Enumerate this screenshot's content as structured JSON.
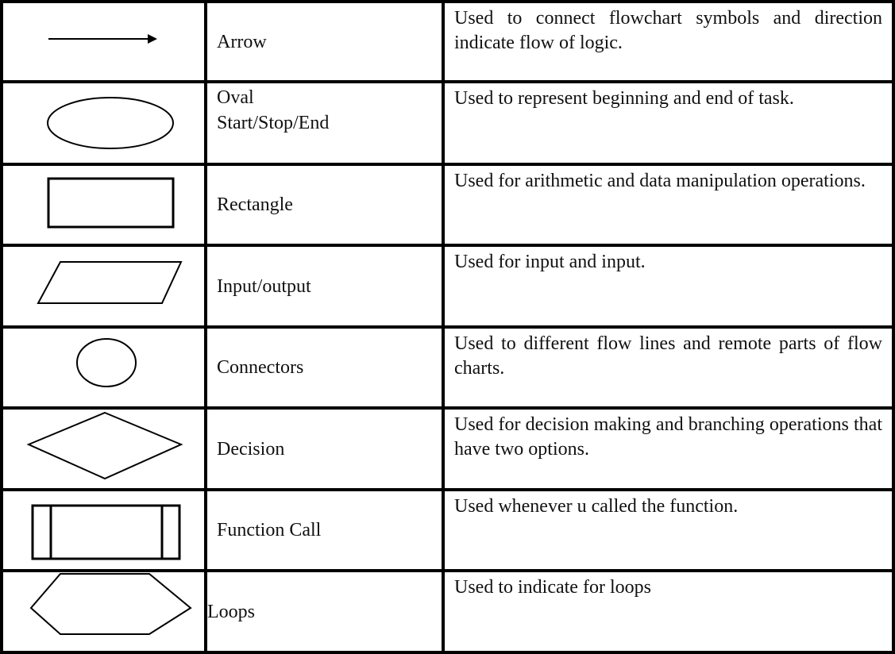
{
  "table": {
    "rows": [
      {
        "symbol": "arrow-icon",
        "name": [
          "Arrow"
        ],
        "description": "Used to connect flowchart symbols and direction indicate flow of logic."
      },
      {
        "symbol": "oval-icon",
        "name": [
          "Oval",
          "Start/Stop/End"
        ],
        "description": "Used to represent beginning and end of task."
      },
      {
        "symbol": "rectangle-icon",
        "name": [
          "Rectangle"
        ],
        "description": "Used for arithmetic and data manipulation operations."
      },
      {
        "symbol": "parallelogram-icon",
        "name": [
          "Input/output"
        ],
        "description": "Used for input and input."
      },
      {
        "symbol": "circle-icon",
        "name": [
          "Connectors"
        ],
        "description": "Used to different flow lines and remote parts of flow charts."
      },
      {
        "symbol": "diamond-icon",
        "name": [
          "Decision"
        ],
        "description": "Used for decision making and branching operations that have two options."
      },
      {
        "symbol": "function-call-icon",
        "name": [
          "Function Call"
        ],
        "description": "Used whenever u called the function."
      },
      {
        "symbol": "hexagon-icon",
        "name": [
          "Loops"
        ],
        "description": "Used to indicate for loops"
      }
    ]
  }
}
